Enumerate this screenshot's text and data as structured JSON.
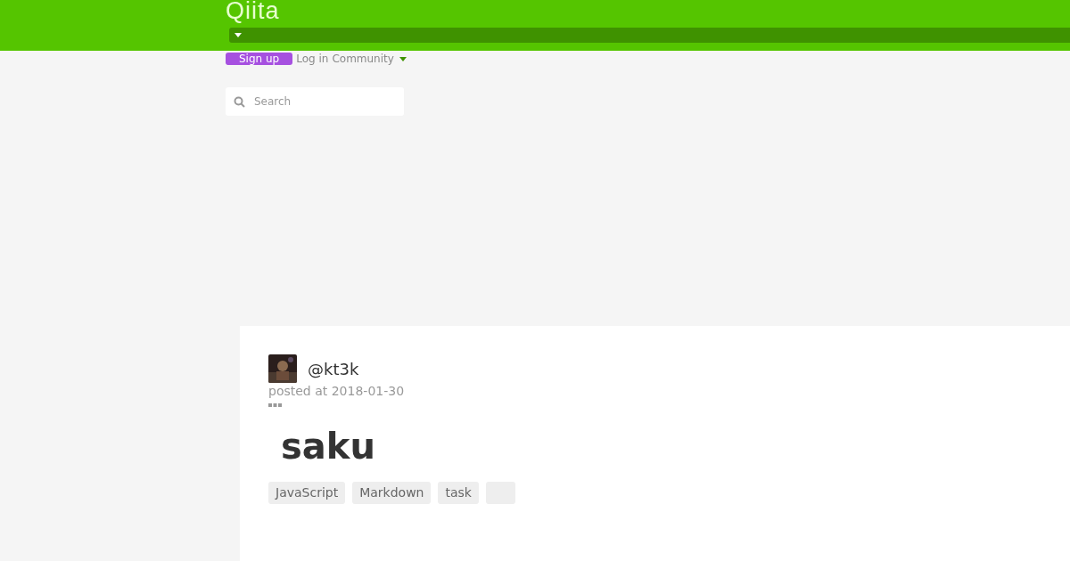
{
  "header": {
    "logo": "Qiita",
    "signup": "Sign up",
    "login": "Log in",
    "community": "Community"
  },
  "search": {
    "placeholder": "Search"
  },
  "article": {
    "author": "@kt3k",
    "posted": "posted at 2018-01-30",
    "title": "saku",
    "tags": [
      {
        "label": "JavaScript"
      },
      {
        "label": "Markdown"
      },
      {
        "label": "task"
      },
      {
        "kind": "blank"
      }
    ]
  }
}
